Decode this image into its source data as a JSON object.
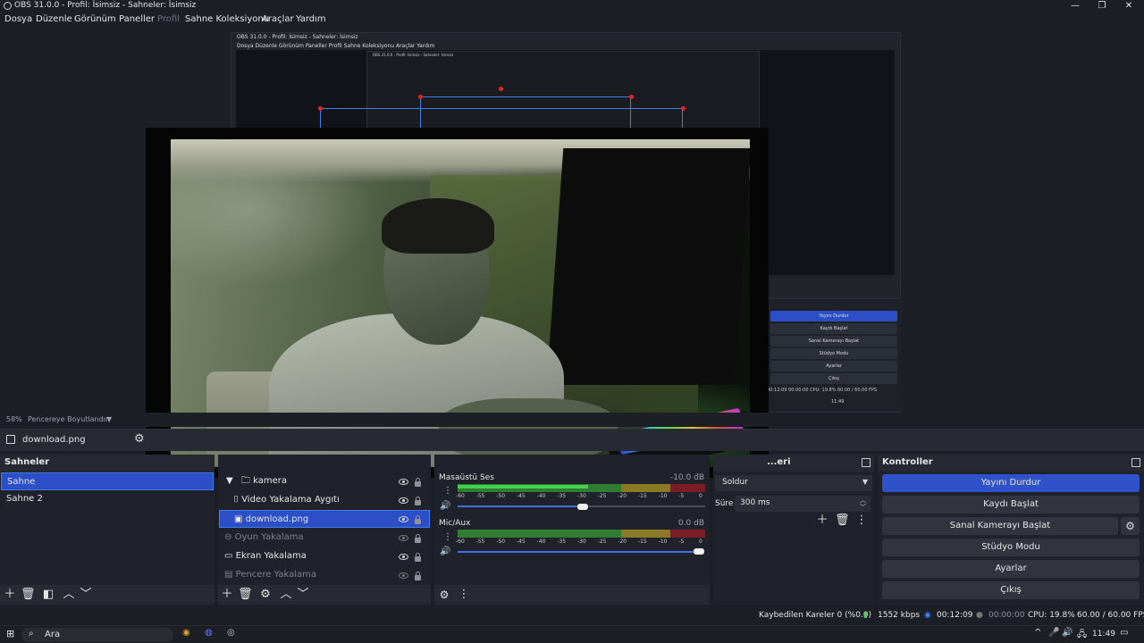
{
  "window": {
    "title": "OBS 31.0.0 - Profil: İsimsiz - Sahneler: İsimsiz",
    "minimize": "—",
    "maximize": "❐",
    "close": "✕"
  },
  "menu": {
    "items": [
      "Dosya",
      "Düzenle",
      "Görünüm",
      "Paneller",
      "Profil",
      "Sahne Koleksiyonu",
      "Araçlar",
      "Yardım"
    ]
  },
  "nested_preview": {
    "title": "OBS 31.0.0 - Profil: İsimsiz - Sahneler: İsimsiz",
    "menu": "Dosya  Düzenle  Görünüm  Paneller  Profil  Sahne Koleksiyonu  Araçlar  Yardım",
    "inner_title": "OBS 31.0.0 - Profil: İsimsiz - Sahneler: İsimsiz",
    "controls": [
      "Yayını Durdur",
      "Kaydı Başlat",
      "Sanal Kamerayı Başlat",
      "Stüdyo Modu",
      "Ayarlar",
      "Çıkış"
    ],
    "status": "00:12:09   00:00:00   CPU: 19.8%   60.00 / 60.00 FPS",
    "clock": "11:49"
  },
  "zoom": {
    "percent": "58%",
    "mode": "Pencereye Boyutlandır"
  },
  "source_toolbar": {
    "selected_source": "download.png"
  },
  "scenes": {
    "title": "Sahneler",
    "items": [
      {
        "label": "Sahne",
        "selected": true
      },
      {
        "label": "Sahne 2",
        "selected": false
      }
    ]
  },
  "sources": {
    "items": [
      {
        "label": "kamera",
        "icon": "folder-icon",
        "visible": true
      },
      {
        "label": "Video Yakalama Aygıtı",
        "icon": "camera-icon",
        "visible": true
      },
      {
        "label": "download.png",
        "icon": "image-icon",
        "visible": true,
        "selected": true
      },
      {
        "label": "Oyun Yakalama",
        "icon": "gamepad-icon",
        "visible": false
      },
      {
        "label": "Ekran Yakalama",
        "icon": "monitor-icon",
        "visible": true
      },
      {
        "label": "Pencere Yakalama",
        "icon": "window-icon",
        "visible": false
      }
    ]
  },
  "mixer": {
    "tracks": [
      {
        "name": "Masaüstü Ses",
        "db": "-10.0 dB",
        "volume": 0.5
      },
      {
        "name": "Mic/Aux",
        "db": "0.0 dB",
        "volume": 1.0
      }
    ],
    "ticks": [
      "-60",
      "-55",
      "-50",
      "-45",
      "-40",
      "-35",
      "-30",
      "-25",
      "-20",
      "-15",
      "-10",
      "-5",
      "0"
    ]
  },
  "transitions": {
    "title": "...eri",
    "selected": "Soldur",
    "duration_label": "Süre",
    "duration_value": "300 ms"
  },
  "controls": {
    "title": "Kontroller",
    "buttons": [
      "Yayını Durdur",
      "Kaydı Başlat",
      "Sanal Kamerayı Başlat",
      "Stüdyo Modu",
      "Ayarlar",
      "Çıkış"
    ]
  },
  "status": {
    "dropped_frames": "Kaybedilen Kareler 0 (%0.0)",
    "bitrate": "1552 kbps",
    "stream_time": "00:12:09",
    "record_time": "00:00:00",
    "cpu": "CPU: 19.8%",
    "fps": "60.00 / 60.00 FPS"
  },
  "taskbar": {
    "search_placeholder": "Ara",
    "clock": "11:49"
  },
  "colors": {
    "accent": "#2f51c9",
    "panel_bg": "#1f222a",
    "meter_green": "#46d14c",
    "meter_yellow": "#8a7a27",
    "meter_red": "#7a1d24"
  }
}
